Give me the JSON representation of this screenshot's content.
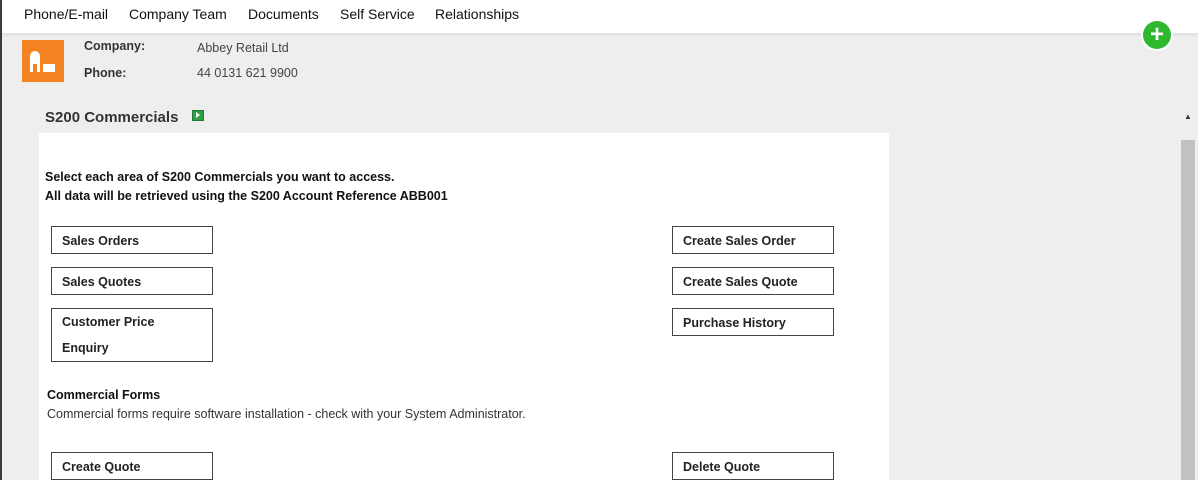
{
  "nav": {
    "tabs": [
      {
        "label": "Phone/E-mail"
      },
      {
        "label": "Company Team"
      },
      {
        "label": "Documents"
      },
      {
        "label": "Self Service"
      },
      {
        "label": "Relationships"
      }
    ]
  },
  "add_button": {
    "icon": "plus-icon",
    "symbol": "+",
    "color": "#2eb82e"
  },
  "company": {
    "logo_color": "#f58220",
    "company_label": "Company:",
    "company_value": "Abbey Retail Ltd",
    "phone_label": "Phone:",
    "phone_value": "44 0131 621 9900"
  },
  "section": {
    "title": "S200 Commercials",
    "intro_line1": "Select each area of S200 Commercials you want to access.",
    "intro_line2": "All data will be retrieved using the S200 Account Reference ABB001",
    "left_buttons": [
      "Sales Orders",
      "Sales Quotes",
      "Customer Price Enquiry"
    ],
    "right_buttons": [
      "Create Sales Order",
      "Create Sales Quote",
      "Purchase History"
    ],
    "forms_title": "Commercial Forms",
    "forms_note": "Commercial forms require software installation - check with your System Administrator.",
    "form_left_button": "Create Quote",
    "form_right_button": "Delete Quote"
  }
}
